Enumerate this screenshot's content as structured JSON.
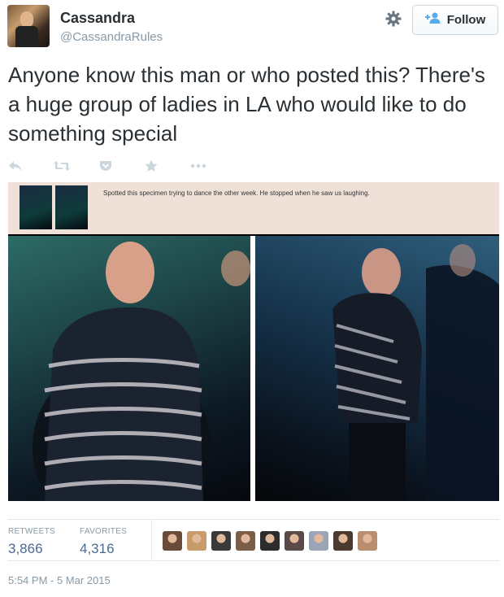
{
  "user": {
    "name": "Cassandra",
    "handle": "@CassandraRules"
  },
  "follow": {
    "label": "Follow"
  },
  "tweet": {
    "text": "Anyone know this man or who posted this? There's a huge group of ladies in LA who would like to do something special"
  },
  "actions": [
    "reply-icon",
    "retweet-icon",
    "pocket-icon",
    "favorite-icon",
    "more-icon"
  ],
  "media": {
    "caption": "Spotted this specimen trying to dance the other week. He stopped when he saw us laughing."
  },
  "stats": {
    "retweets_label": "RETWEETS",
    "retweets_value": "3,866",
    "favorites_label": "FAVORITES",
    "favorites_value": "4,316"
  },
  "favoriters": [
    "#6a4b3a",
    "#c99a6a",
    "#3a3a3a",
    "#7a5e48",
    "#2c2c2c",
    "#5a4a4a",
    "#9aa6b8",
    "#4a3a30",
    "#b88e6e"
  ],
  "timestamp": "5:54 PM - 5 Mar 2015",
  "colors": {
    "link": "#4b6a92",
    "muted": "#8899a6",
    "text": "#292f33",
    "follow_icon": "#55acee"
  }
}
